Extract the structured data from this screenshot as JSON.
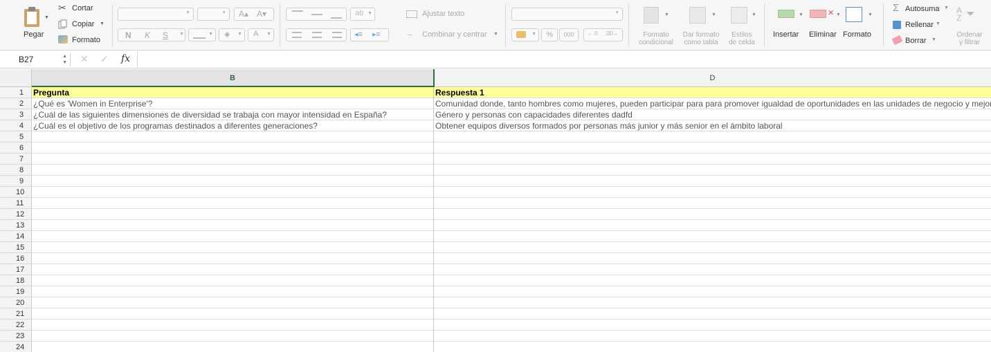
{
  "ribbon": {
    "paste": "Pegar",
    "cut": "Cortar",
    "copy": "Copiar",
    "format_painter": "Formato",
    "bold": "N",
    "italic": "K",
    "underline": "S",
    "wrap_text": "Ajustar texto",
    "merge_center": "Combinar y centrar",
    "percent": "%",
    "thousands": "000",
    "cond_format": [
      "Formato",
      "condicional"
    ],
    "format_table": [
      "Dar formato",
      "como tabla"
    ],
    "cell_styles": [
      "Estilos",
      "de celda"
    ],
    "insert": "Insertar",
    "delete": "Eliminar",
    "format": "Formato",
    "autosum": "Autosuma",
    "fill": "Rellenar",
    "clear": "Borrar",
    "sort_filter": [
      "Ordenar",
      "y filtrar"
    ]
  },
  "formula_bar": {
    "name_box": "B27",
    "fx": "fx",
    "cancel": "✕",
    "confirm": "✓",
    "formula": ""
  },
  "columns": [
    "B",
    "D"
  ],
  "rows": [
    {
      "n": "1",
      "b": "Pregunta",
      "d": "Respuesta 1",
      "header": true
    },
    {
      "n": "2",
      "b": "¿Qué es 'Women in Enterprise'?",
      "d": "Comunidad donde, tanto hombres como mujeres, pueden participar para para promover igualdad de oportunidades en las unidades de negocio y mejor"
    },
    {
      "n": "3",
      "b": "¿Cuál de las siguientes dimensiones de diversidad se trabaja con mayor intensidad en España?",
      "d": "Género y personas con capacidades diferentes dadfd"
    },
    {
      "n": "4",
      "b": "¿Cuál es el objetivo de los programas destinados a diferentes generaciones?",
      "d": "Obtener equipos diversos formados por personas más junior y más senior en el ámbito laboral"
    },
    {
      "n": "5",
      "b": "",
      "d": ""
    },
    {
      "n": "6",
      "b": "",
      "d": ""
    },
    {
      "n": "7",
      "b": "",
      "d": ""
    },
    {
      "n": "8",
      "b": "",
      "d": ""
    },
    {
      "n": "9",
      "b": "",
      "d": ""
    },
    {
      "n": "10",
      "b": "",
      "d": ""
    },
    {
      "n": "11",
      "b": "",
      "d": ""
    },
    {
      "n": "12",
      "b": "",
      "d": ""
    },
    {
      "n": "13",
      "b": "",
      "d": ""
    },
    {
      "n": "14",
      "b": "",
      "d": ""
    },
    {
      "n": "15",
      "b": "",
      "d": ""
    },
    {
      "n": "16",
      "b": "",
      "d": ""
    },
    {
      "n": "17",
      "b": "",
      "d": ""
    },
    {
      "n": "18",
      "b": "",
      "d": ""
    },
    {
      "n": "19",
      "b": "",
      "d": ""
    },
    {
      "n": "20",
      "b": "",
      "d": ""
    },
    {
      "n": "21",
      "b": "",
      "d": ""
    },
    {
      "n": "22",
      "b": "",
      "d": ""
    },
    {
      "n": "23",
      "b": "",
      "d": ""
    },
    {
      "n": "24",
      "b": "",
      "d": ""
    }
  ]
}
